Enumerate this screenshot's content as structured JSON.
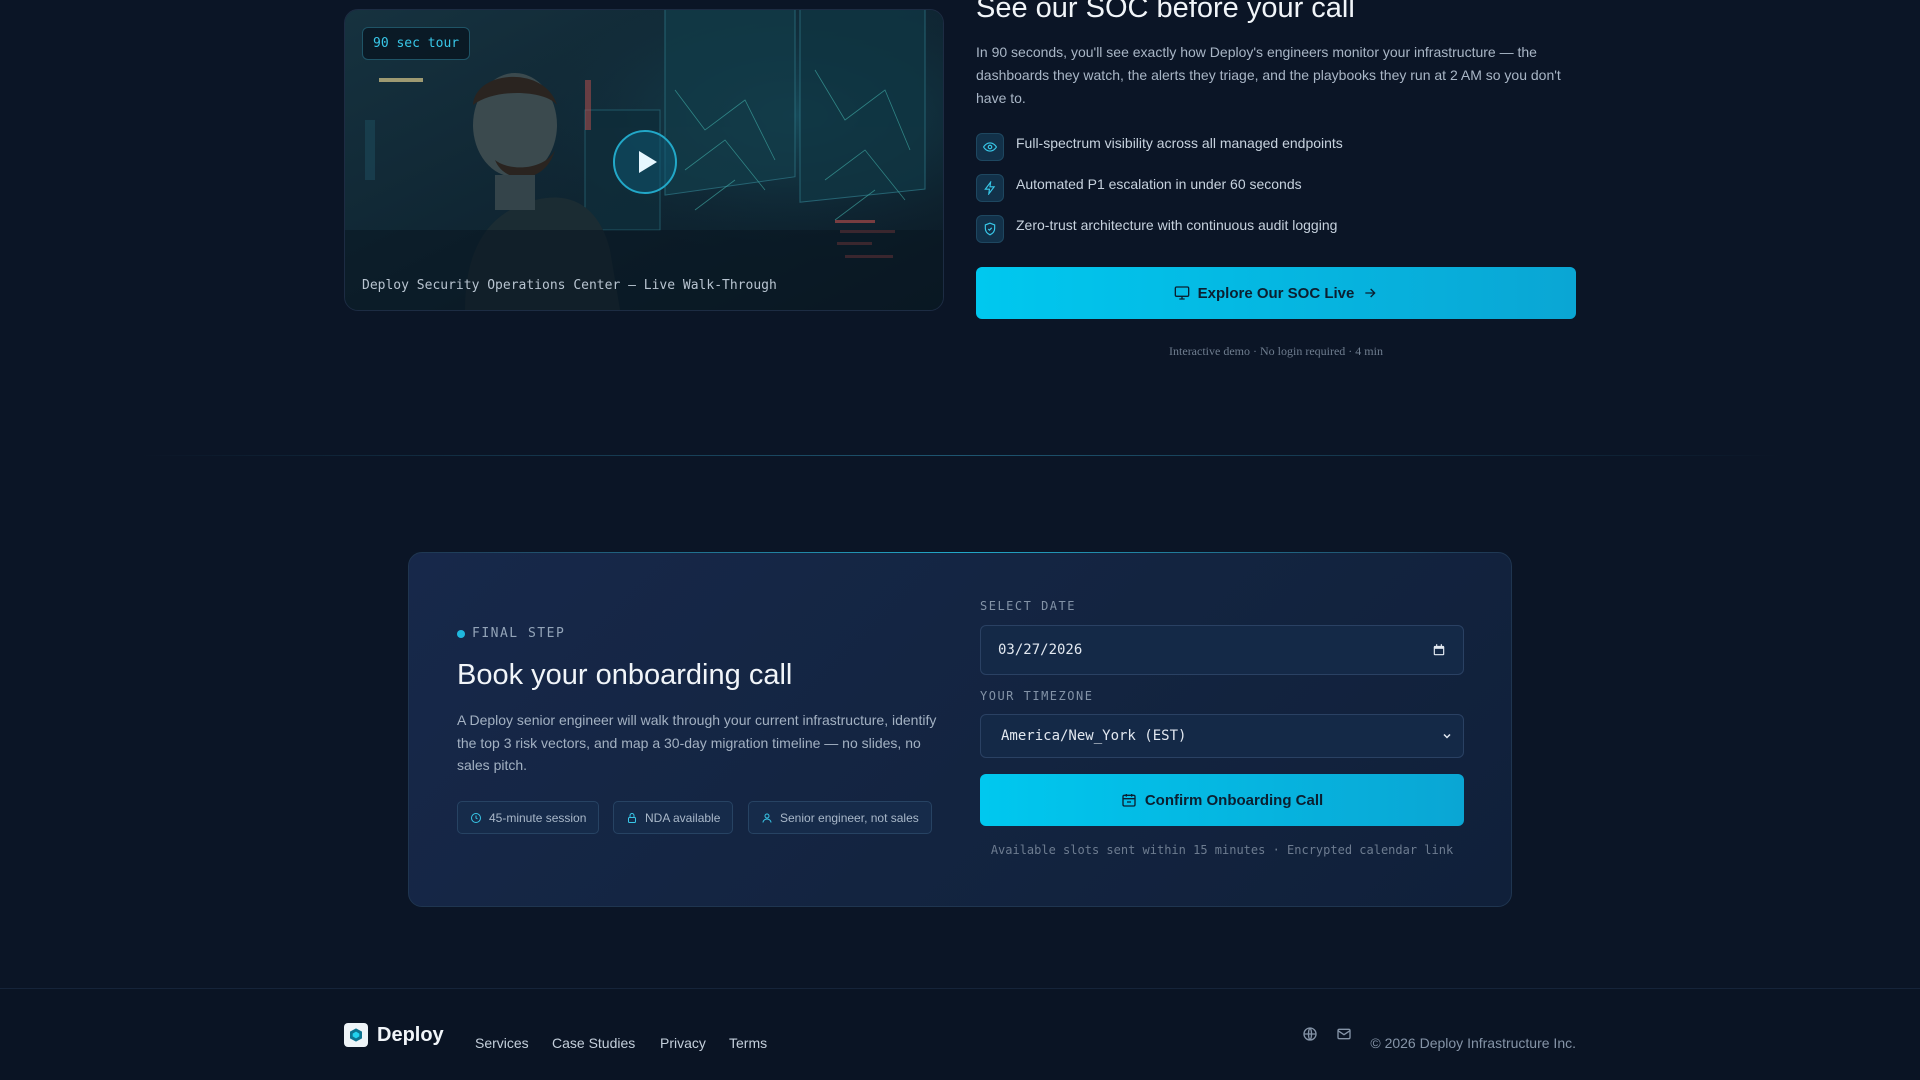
{
  "video": {
    "badge": "90 sec tour",
    "caption": "Deploy Security Operations Center — Live Walk-Through"
  },
  "soc": {
    "title": "See our SOC before your call",
    "description": "In 90 seconds, you'll see exactly how Deploy's engineers monitor your infrastructure — the dashboards they watch, the alerts they triage, and the playbooks they run at 2 AM so you don't have to.",
    "features": [
      {
        "icon": "eye-icon",
        "text": "Full-spectrum visibility across all managed endpoints"
      },
      {
        "icon": "bolt-icon",
        "text": "Automated P1 escalation in under 60 seconds"
      },
      {
        "icon": "shield-icon",
        "text": "Zero-trust architecture with continuous audit logging"
      }
    ],
    "cta_label": "Explore Our SOC Live",
    "cta_note": "Interactive demo · No login required · 4 min"
  },
  "booking": {
    "step_label": "FINAL STEP",
    "title": "Book your onboarding call",
    "description": "A Deploy senior engineer will walk through your current infrastructure, identify the top 3 risk vectors, and map a 30-day migration timeline — no slides, no sales pitch.",
    "chips": [
      {
        "icon": "clock-icon",
        "text": "45-minute session"
      },
      {
        "icon": "lock-icon",
        "text": "NDA available"
      },
      {
        "icon": "user-icon",
        "text": "Senior engineer, not sales"
      }
    ],
    "date_label": "SELECT DATE",
    "date_value": "03/27/2026",
    "timezone_label": "YOUR TIMEZONE",
    "timezone_value": "America/New_York (EST)",
    "confirm_label": "Confirm Onboarding Call",
    "confirm_note": "Available slots sent within 15 minutes · Encrypted calendar link"
  },
  "footer": {
    "brand": "Deploy",
    "links": [
      "Services",
      "Case Studies",
      "Privacy",
      "Terms"
    ],
    "copyright": "© 2026 Deploy Infrastructure Inc."
  },
  "colors": {
    "background": "#0b1526",
    "accent": "#00c8ef",
    "card": "#17284a"
  }
}
